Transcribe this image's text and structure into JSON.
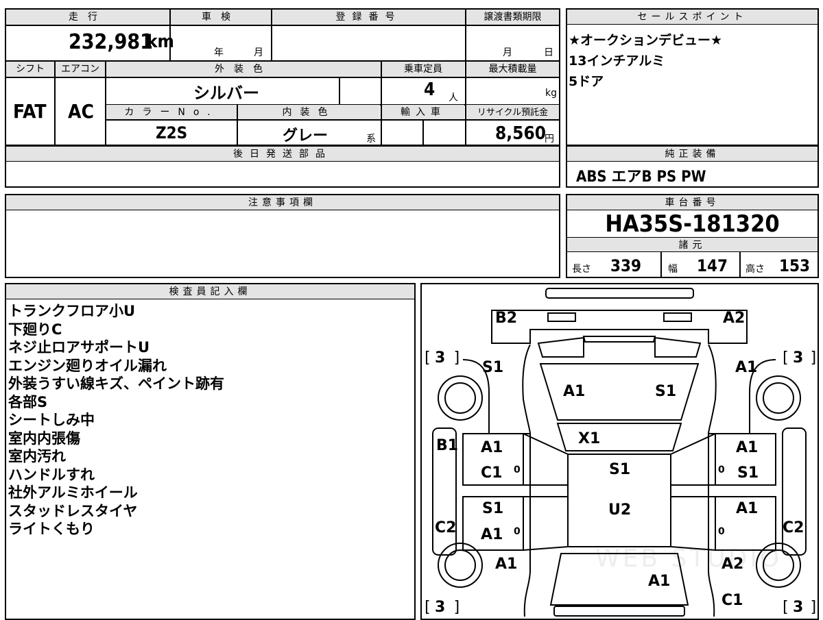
{
  "basic": {
    "mileage_label": "走行",
    "mileage_value": "232,981",
    "mileage_unit": "km",
    "inspection_label": "車検",
    "inspection_year": "年",
    "inspection_month": "月",
    "registration_label": "登録番号",
    "transfer_deadline_label": "譲渡書類期限",
    "transfer_month": "月",
    "transfer_day": "日",
    "shift_label": "シフト",
    "shift_value": "FAT",
    "ac_label": "エアコン",
    "ac_value": "AC",
    "exterior_color_label": "外装色",
    "exterior_color_value": "シルバー",
    "capacity_label": "乗車定員",
    "capacity_value": "4",
    "capacity_unit": "人",
    "max_load_label": "最大積載量",
    "max_load_unit": "kg",
    "color_no_label": "カラーNo.",
    "color_no_value": "Z2S",
    "interior_color_label": "内装色",
    "interior_color_value": "グレー",
    "interior_suffix": "系",
    "import_label": "輸入車",
    "recycle_label": "リサイクル預託金",
    "recycle_value": "8,560",
    "recycle_unit": "円",
    "later_parts_label": "後日発送部品"
  },
  "sales_points": {
    "label": "セールスポイント",
    "lines": [
      "★オークションデビュー★",
      "13インチアルミ",
      "5ドア"
    ]
  },
  "equipment": {
    "label": "純正装備",
    "value": "ABS エアB PS PW"
  },
  "notes_box": {
    "label": "注意事項欄"
  },
  "chassis": {
    "label": "車台番号",
    "value": "HA35S-181320",
    "spec_label": "諸元",
    "length_label": "長さ",
    "length_value": "339",
    "width_label": "幅",
    "width_value": "147",
    "height_label": "高さ",
    "height_value": "153"
  },
  "inspector": {
    "label": "検査員記入欄",
    "lines": [
      "トランクフロア小U",
      "下廻りC",
      "ネジ止ロアサポートU",
      "エンジン廻りオイル漏れ",
      "外装うすい線キズ、ペイント跡有",
      "各部S",
      "シートしみ中",
      "室内内張傷",
      "室内汚れ",
      "ハンドルすれ",
      "社外アルミホイール",
      "スタッドレスタイヤ",
      "ライトくもり"
    ]
  },
  "diagram": {
    "codes": {
      "rear_left": "B2",
      "rear_right": "A2",
      "tire_rl": "3",
      "tire_rr": "3",
      "tire_fl": "3",
      "tire_fr": "3",
      "rear_quarter_left": "S1",
      "rear_quarter_right": "A1",
      "roof_left": "A1",
      "roof_right": "S1",
      "rear_glass": "X1",
      "sill_left": "B1",
      "rear_door_left_1": "A1",
      "rear_door_left_2": "C1",
      "rear_door_right_1": "A1",
      "rear_door_right_2": "S1",
      "front_door_left_1": "S1",
      "front_door_left_2": "A1",
      "front_door_right": "A1",
      "cabin_rear": "S1",
      "cabin_front": "U2",
      "pillar_left": "C2",
      "pillar_right": "C2",
      "fender_left": "A1",
      "fender_right": "A2",
      "hood": "A1",
      "front_bumper_right": "C1",
      "zero": "0"
    },
    "watermark": "WEB STUDIO"
  }
}
